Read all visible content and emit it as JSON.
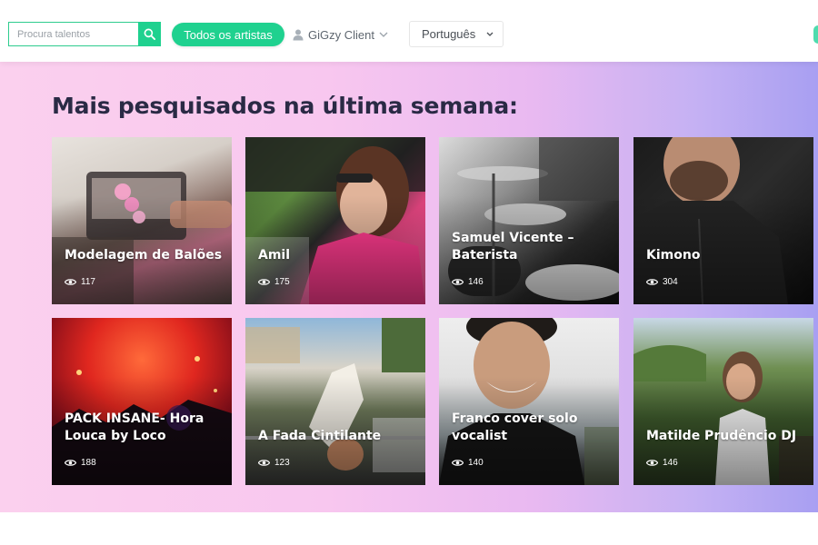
{
  "header": {
    "search_placeholder": "Procura talentos",
    "all_artists_label": "Todos os artistas",
    "client_label": "GiGzy Client",
    "language_label": "Português"
  },
  "section": {
    "title": "Mais pesquisados na última semana:"
  },
  "cards": [
    {
      "name": "Modelagem de Balões",
      "views": "117"
    },
    {
      "name": "Amil",
      "views": "175"
    },
    {
      "name": "Samuel Vicente – Baterista",
      "views": "146"
    },
    {
      "name": "Kimono",
      "views": "304"
    },
    {
      "name": "PACK INSANE- Hora Louca by Loco",
      "views": "188"
    },
    {
      "name": "A Fada Cintilante",
      "views": "123"
    },
    {
      "name": "Franco cover solo vocalist",
      "views": "140"
    },
    {
      "name": "Matilde Prudêncio DJ",
      "views": "146"
    }
  ],
  "colors": {
    "accent": "#1fd18f",
    "title": "#2a2a45",
    "gradient_left": "#fbd0ee",
    "gradient_right": "#a89ff2"
  }
}
